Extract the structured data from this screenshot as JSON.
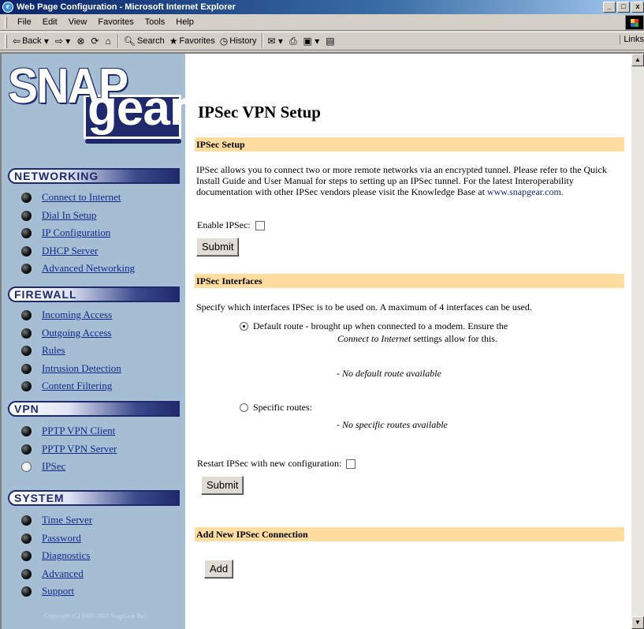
{
  "window": {
    "title": "Web Page Configuration - Microsoft Internet Explorer",
    "btn_min": "_",
    "btn_max": "□",
    "btn_close": "x"
  },
  "menu": [
    "File",
    "Edit",
    "View",
    "Favorites",
    "Tools",
    "Help"
  ],
  "toolbar": {
    "back": "Back",
    "search": "Search",
    "favorites": "Favorites",
    "history": "History",
    "links": "Links"
  },
  "sidebar": {
    "logo_top": "SNAP",
    "logo_bottom": "gear",
    "networking": {
      "title": "NETWORKING",
      "items": [
        "Connect to Internet",
        "Dial In Setup",
        "IP Configuration",
        "DHCP Server",
        "Advanced Networking"
      ]
    },
    "firewall": {
      "title": "FIREWALL",
      "items": [
        "Incoming Access",
        "Outgoing Access",
        "Rules",
        "Intrusion Detection",
        "Content Filtering"
      ]
    },
    "vpn": {
      "title": "VPN",
      "items": [
        "PPTP VPN Client",
        "PPTP VPN Server",
        "IPSec"
      ]
    },
    "system": {
      "title": "SYSTEM",
      "items": [
        "Time Server",
        "Password",
        "Diagnostics",
        "Advanced",
        "Support"
      ]
    },
    "copyright": "Copyright (C) 1999-2002 SnapGear Inc."
  },
  "main": {
    "title": "IPSec VPN Setup",
    "setup": {
      "header": "IPSec Setup",
      "description": "IPSec allows you to connect two or more remote networks via an encrypted tunnel. Please refer to the Quick Install Guide and User Manual for steps to setting up an IPSec tunnel. For the latest Interoperability documentation with other IPSec vendors please visit the Knowledge Base at",
      "link": "www.snapgear.com.",
      "enable_label": "Enable IPSec:",
      "submit": "Submit"
    },
    "interfaces": {
      "header": "IPSec Interfaces",
      "description": "Specify which interfaces IPSec is to be used on. A maximum of 4 interfaces can be used.",
      "default_route": "Default route - brought up when connected to a modem. Ensure the",
      "default_route_note_italic": "Connect to Internet",
      "default_route_note_rest": "settings allow for this.",
      "no_default": "- No default route available",
      "specific_routes": "Specific routes:",
      "no_specific": "- No specific routes available",
      "restart_label": "Restart IPSec with new configuration:",
      "submit": "Submit"
    },
    "add": {
      "header": "Add New IPSec Connection",
      "button": "Add"
    }
  }
}
